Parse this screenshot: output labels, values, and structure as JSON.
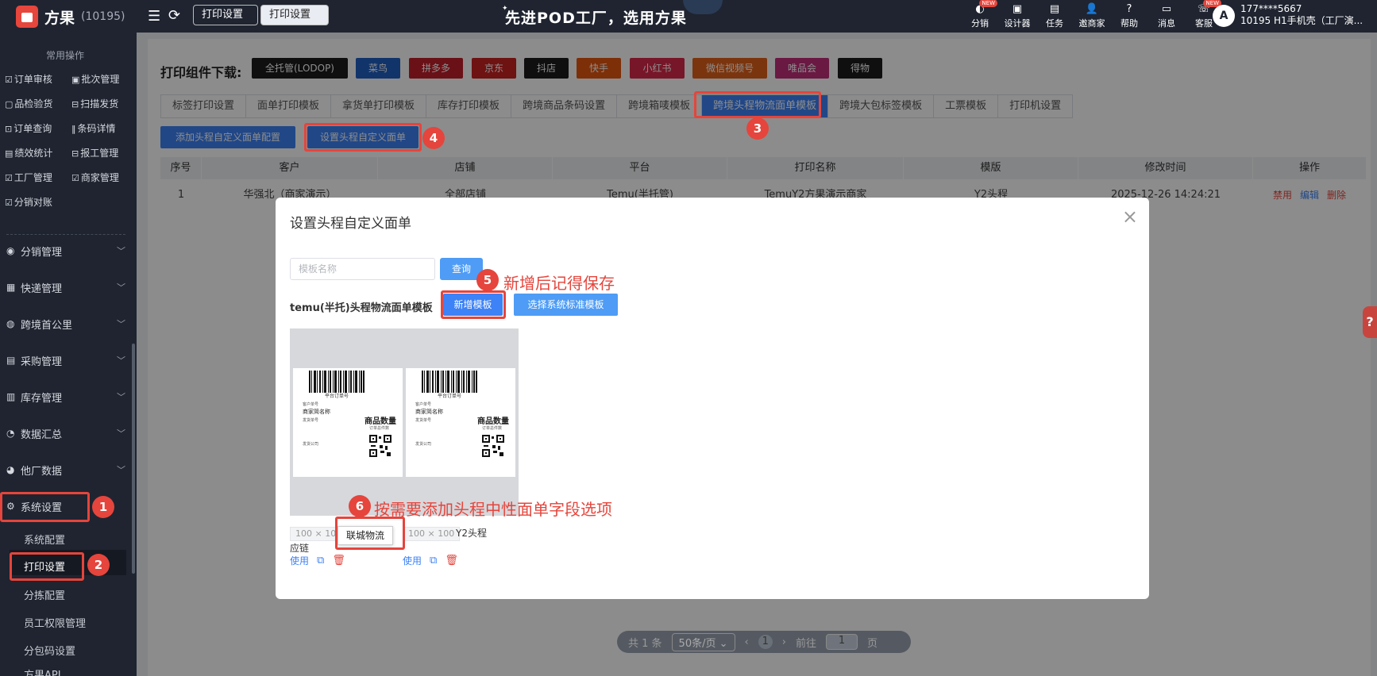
{
  "topbar": {
    "brand": "方果",
    "brand_id": "(10195)",
    "tabs": [
      "打印设置",
      "打印设置"
    ],
    "slogan": "先进POD工厂，选用方果",
    "icons": [
      {
        "label": "分销",
        "badge": "NEW",
        "icon": "share-icon"
      },
      {
        "label": "设计器",
        "icon": "design-icon"
      },
      {
        "label": "任务",
        "icon": "task-icon"
      },
      {
        "label": "邀商家",
        "icon": "invite-icon"
      },
      {
        "label": "帮助",
        "icon": "help-icon"
      },
      {
        "label": "消息",
        "icon": "message-icon"
      },
      {
        "label": "客服",
        "badge": "NEW",
        "icon": "service-icon"
      }
    ],
    "avatar_letter": "A",
    "user_phone": "177****5667",
    "user_name": "10195 H1手机壳（工厂演..."
  },
  "sidebar": {
    "section_title": "常用操作",
    "quick_ops": [
      "订单审核",
      "批次管理",
      "品检验货",
      "扫描发货",
      "订单查询",
      "条码详情",
      "绩效统计",
      "报工管理",
      "工厂管理",
      "商家管理",
      "分销对账"
    ],
    "menus": [
      "分销管理",
      "快递管理",
      "跨境首公里",
      "采购管理",
      "库存管理",
      "数据汇总",
      "他厂数据",
      "系统设置"
    ],
    "sub_items": [
      "系统配置",
      "打印设置",
      "分拣配置",
      "员工权限管理",
      "分包码设置",
      "方果API"
    ]
  },
  "downloads": {
    "label": "打印组件下载:",
    "items": [
      {
        "label": "全托管(LODOP)",
        "color": "#1d1d1d"
      },
      {
        "label": "菜鸟",
        "color": "#1f5fc4"
      },
      {
        "label": "拼多多",
        "color": "#c0202a"
      },
      {
        "label": "京东",
        "color": "#c92222"
      },
      {
        "label": "抖店",
        "color": "#1d1d1d"
      },
      {
        "label": "快手",
        "color": "#e3570f"
      },
      {
        "label": "小红书",
        "color": "#d9284a"
      },
      {
        "label": "微信视频号",
        "color": "#e0621a"
      },
      {
        "label": "唯品会",
        "color": "#c22e7a"
      },
      {
        "label": "得物",
        "color": "#1d1d1d"
      }
    ]
  },
  "tabs": [
    "标签打印设置",
    "面单打印模板",
    "拿货单打印模板",
    "库存打印模板",
    "跨境商品条码设置",
    "跨境箱唛模板",
    "跨境头程物流面单模板",
    "跨境大包标签模板",
    "工票模板",
    "打印机设置"
  ],
  "actions": {
    "add_config": "添加头程自定义面单配置",
    "set_custom": "设置头程自定义面单"
  },
  "table": {
    "headers": [
      "序号",
      "客户",
      "店铺",
      "平台",
      "打印名称",
      "模版",
      "修改时间",
      "操作"
    ],
    "rows": [
      {
        "no": "1",
        "customer": "华强北（商家演示）",
        "shop": "全部店铺",
        "platform": "Temu(半托管)",
        "print_name": "TemuY2方果演示商家",
        "template": "Y2头程",
        "time": "2025-12-26 14:24:21",
        "ops": [
          "禁用",
          "编辑",
          "删除"
        ]
      }
    ]
  },
  "pagination": {
    "total": "共 1 条",
    "page_size": "50条/页",
    "current": "1",
    "goto_label": "前往",
    "goto_value": "1",
    "page_unit": "页"
  },
  "modal": {
    "title": "设置头程自定义面单",
    "search_placeholder": "模板名称",
    "query": "查询",
    "tpl_label": "temu(半托)头程物流面单模板",
    "add_btn": "新增模板",
    "sys_btn": "选择系统标准模板",
    "cards": [
      {
        "size": "100 × 10",
        "name": "应链",
        "use": "使用"
      },
      {
        "size": "100 × 100",
        "name": "Y2头程",
        "use": "使用"
      }
    ],
    "label_preview": {
      "barcode_text": "平台订单号",
      "small_top": "客户单号",
      "shop": "商家简名称",
      "small_mid": "发货单号",
      "qty": "商品数量",
      "small_qty": "订单总件数",
      "small_bottom": "发货公司"
    },
    "tooltip": "联城物流"
  },
  "annotations": {
    "n1": "1",
    "n2": "2",
    "n3": "3",
    "n4": "4",
    "n5": "5",
    "n6": "6",
    "note5": "新增后记得保存",
    "note6": "按需要添加头程中性面单字段选项"
  }
}
